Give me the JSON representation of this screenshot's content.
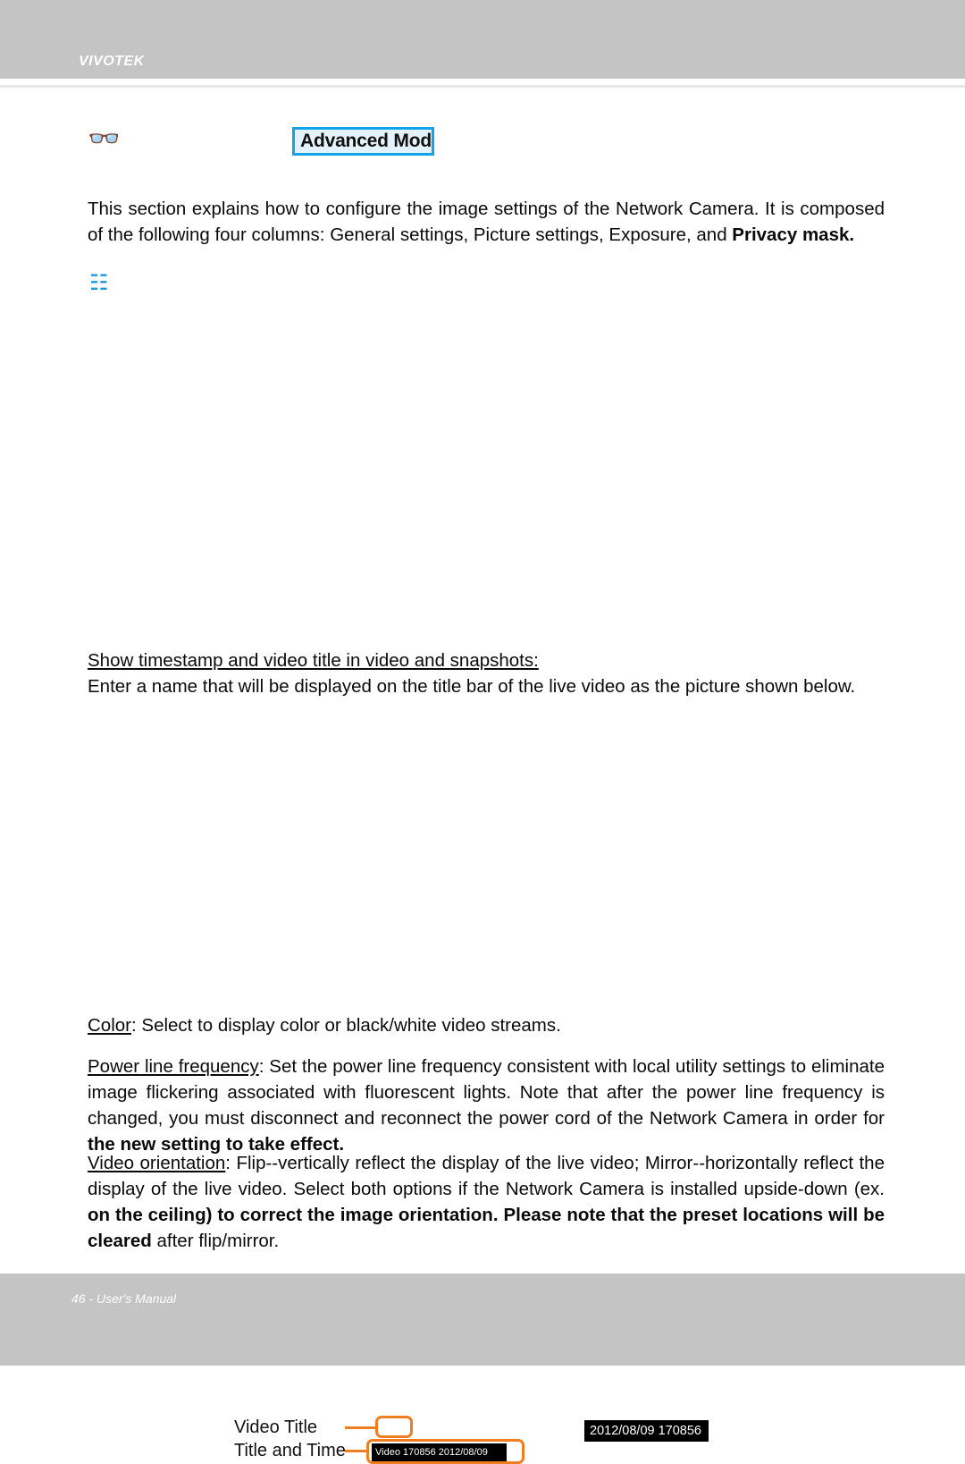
{
  "page": {
    "brand": "VIVOTEK",
    "footer_text": "46 - User's Manual",
    "page_number": "46",
    "colors": {
      "header_bar": "#c4c4c4",
      "footer_bar": "#c4c4c4",
      "accent_blue": "#12a3e8",
      "accent_orange": "#ef7d21",
      "osd_background": "#000000",
      "body_text": "#0a0a0a"
    }
  },
  "mode_badge": {
    "label": "Advanced Mode",
    "icon": "binoculars-icon"
  },
  "intro": {
    "text_part1": "This section explains how to configure the image settings of the Network Camera. It is composed of the following four columns: General settings, Picture settings, Exposure, and ",
    "text_bold": "Privacy mask."
  },
  "timestamp_section": {
    "heading": "Show timestamp and video title in video and snapshots:",
    "description": "Enter a name that will be displayed on the title bar of the live video as the picture shown below."
  },
  "diagram": {
    "label_video_title": "Video Title",
    "label_title_and_time": "Title and Time",
    "osd_title_and_time": "Video 170856  2012/08/09",
    "osd_timestamp_sample": "2012/08/09  170856"
  },
  "settings": {
    "color": {
      "term": "Color",
      "body": ": Select to display color or black/white video streams."
    },
    "power_line_frequency": {
      "term": "Power line frequency",
      "body": ": Set the power line frequency consistent with local utility settings to eliminate image flickering associated with fluorescent lights. Note that after the power line frequency is changed, you must disconnect and reconnect the power cord of the Network Camera in order for ",
      "body_bold": "the new setting to take effect."
    },
    "video_orientation": {
      "term": "Video orientation",
      "body": ": Flip--vertically reflect the display of the live video; Mirror--horizontally reflect the display of the live video. Select both options if the Network Camera is installed upside-down (ex. ",
      "body_bold": "on the ceiling) to correct the image orientation. Please note that the preset locations will be cleared ",
      "body_tail": "after flip/mirror."
    }
  }
}
